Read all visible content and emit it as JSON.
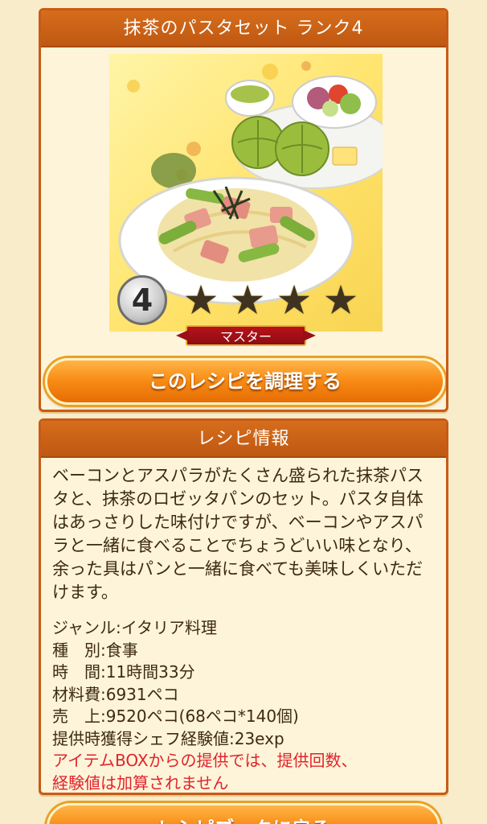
{
  "recipe_panel": {
    "title": "抹茶のパスタセット ランク4",
    "rank": "4",
    "stars": [
      "★",
      "★",
      "★",
      "★"
    ],
    "mastery_label": "マスター",
    "cook_button_label": "このレシピを調理する"
  },
  "info_panel": {
    "title": "レシピ情報",
    "description": "ベーコンとアスパラがたくさん盛られた抹茶パスタと、抹茶のロゼッタパンのセット。パスタ自体はあっさりした味付けですが、ベーコンやアスパラと一緒に食べることでちょうどいい味となり、余った具はパンと一緒に食べても美味しくいただけます。",
    "genre": "ジャンル:イタリア料理",
    "type": "種　別:食事",
    "time": "時　間:11時間33分",
    "cost": "材料費:6931ペコ",
    "sales": "売　上:9520ペコ(68ペコ*140個)",
    "exp": "提供時獲得シェフ経験値:23exp",
    "warning_line1": "アイテムBOXからの提供では、提供回数、",
    "warning_line2": "経験値は加算されません"
  },
  "footer": {
    "back_button_label": "レシピブックに戻る"
  },
  "colors": {
    "header": "#c85a16",
    "button": "#f78a14",
    "warning": "#e0242d",
    "text": "#3e2a12"
  }
}
